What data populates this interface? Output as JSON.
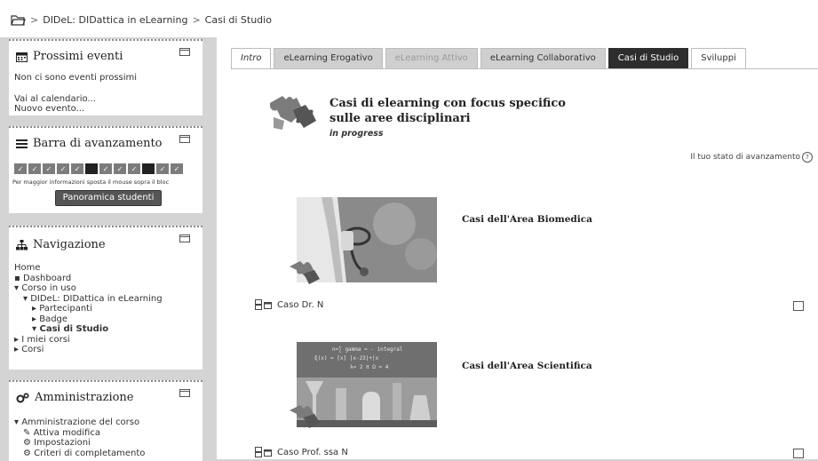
{
  "breadcrumb": {
    "items": [
      "DIDeL: DIDattica in eLearning",
      "Casi di Studio"
    ],
    "separator": ">"
  },
  "blocks": {
    "upcoming": {
      "title": "Prossimi eventi",
      "empty_text": "Non ci sono eventi prossimi",
      "links": [
        "Vai al calendario...",
        "Nuovo evento..."
      ]
    },
    "progress": {
      "title": "Barra di avanzamento",
      "hint": "Per maggior informazioni sposta il mouse sopra il bloc",
      "button": "Panoramica studenti",
      "cells": [
        "done",
        "done",
        "done",
        "done",
        "done",
        "todo",
        "done",
        "done",
        "done",
        "todo",
        "done",
        "done"
      ]
    },
    "navigation": {
      "title": "Navigazione",
      "items": [
        {
          "label": "Home",
          "marker": "",
          "indent": 0,
          "bold": false
        },
        {
          "label": "Dashboard",
          "marker": "▪",
          "indent": 0,
          "bold": false
        },
        {
          "label": "Corso in uso",
          "marker": "▾",
          "indent": 0,
          "bold": false
        },
        {
          "label": "DIDeL: DIDattica in eLearning",
          "marker": "▾",
          "indent": 1,
          "bold": false
        },
        {
          "label": "Partecipanti",
          "marker": "▸",
          "indent": 2,
          "bold": false
        },
        {
          "label": "Badge",
          "marker": "▸",
          "indent": 2,
          "bold": false
        },
        {
          "label": "Casi di Studio",
          "marker": "▾",
          "indent": 2,
          "bold": true
        },
        {
          "label": "I miei corsi",
          "marker": "▸",
          "indent": 0,
          "bold": false
        },
        {
          "label": "Corsi",
          "marker": "▸",
          "indent": 0,
          "bold": false
        }
      ]
    },
    "admin": {
      "title": "Amministrazione",
      "items": [
        {
          "label": "Amministrazione del corso",
          "marker": "▾",
          "indent": 0
        },
        {
          "label": "Attiva modifica",
          "marker": "✎",
          "indent": 1
        },
        {
          "label": "Impostazioni",
          "marker": "⚙",
          "indent": 1
        },
        {
          "label": "Criteri di completamento",
          "marker": "⚙",
          "indent": 1
        }
      ]
    }
  },
  "tabs": [
    {
      "label": "Intro",
      "style": "intro"
    },
    {
      "label": "eLearning Erogativo",
      "style": "normal"
    },
    {
      "label": "eLearning Attivo",
      "style": "muted"
    },
    {
      "label": "eLearning Collaborativo",
      "style": "normal"
    },
    {
      "label": "Casi di Studio",
      "style": "dark"
    },
    {
      "label": "Sviluppi",
      "style": "light"
    }
  ],
  "main": {
    "headline_line1": "Casi di elearning con focus specifico",
    "headline_line2": "sulle aree disciplinari",
    "status": "in progress",
    "progress_label": "Il tuo stato di avanzamento",
    "sections": [
      {
        "title": "Casi dell'Area Biomedica",
        "activity": "Caso Dr. N",
        "image": "doctor-stethoscope"
      },
      {
        "title": "Casi dell'Area Scientifica",
        "activity": "Caso Prof. ssa N",
        "image": "science-lab"
      }
    ]
  },
  "colors": {
    "dark_tab": "#2d2d2d",
    "page_bg": "#d4d4d4",
    "block_bg": "#ffffff"
  }
}
